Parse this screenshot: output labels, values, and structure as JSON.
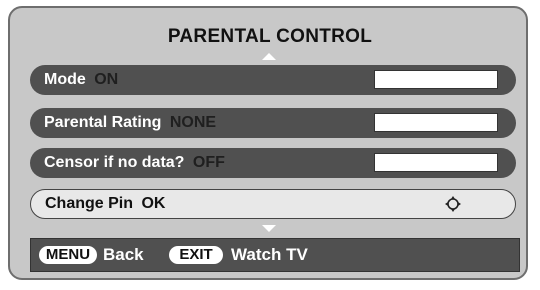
{
  "menu": {
    "title": "PARENTAL CONTROL",
    "items": [
      {
        "label": "Mode",
        "value": "ON"
      },
      {
        "label": "Parental Rating",
        "value": "NONE"
      },
      {
        "label": "Censor if no data?",
        "value": "OFF"
      },
      {
        "label": "Change Pin",
        "value": "OK"
      }
    ]
  },
  "footer": {
    "menu_key": "MENU",
    "menu_action": "Back",
    "exit_key": "EXIT",
    "exit_action": "Watch TV"
  },
  "icons": {
    "scroll_up": "arrow-up-icon",
    "scroll_down": "arrow-down-icon",
    "navigate": "navigation-pad-icon"
  },
  "colors": {
    "panel": "#c8c8c8",
    "row": "#505050",
    "selected_row": "#e8e8e8",
    "text_light": "#ffffff"
  }
}
